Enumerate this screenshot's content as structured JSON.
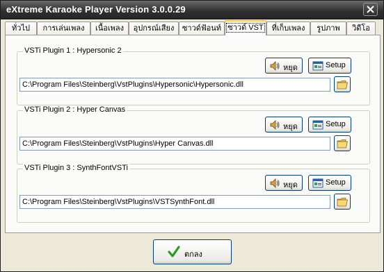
{
  "window": {
    "title": "eXtreme Karaoke Player Version 3.0.0.29"
  },
  "tabs": [
    {
      "label": "ทั่วไป"
    },
    {
      "label": "การเล่นเพลง"
    },
    {
      "label": "เนื้อเพลง"
    },
    {
      "label": "อุปกรณ์เสียง"
    },
    {
      "label": "ซาวด์ฟ้อนท์"
    },
    {
      "label": "ซาวด์ VST",
      "active": true
    },
    {
      "label": "ที่เก็บเพลง"
    },
    {
      "label": "รูปภาพ"
    },
    {
      "label": "วิดีโอ"
    }
  ],
  "plugins": [
    {
      "title": "VSTi Plugin 1 : Hypersonic 2",
      "stop_label": "หยุด",
      "setup_label": "Setup",
      "path": "C:\\Program Files\\Steinberg\\VstPlugins\\Hypersonic\\Hypersonic.dll"
    },
    {
      "title": "VSTi Plugin 2 : Hyper Canvas",
      "stop_label": "หยุด",
      "setup_label": "Setup",
      "path": "C:\\Program Files\\Steinberg\\VstPlugins\\Hyper Canvas.dll"
    },
    {
      "title": "VSTi Plugin 3 : SynthFontVSTi",
      "stop_label": "หยุด",
      "setup_label": "Setup",
      "path": "C:\\Program Files\\Steinberg\\VstPlugins\\VSTSynthFont.dll"
    }
  ],
  "footer": {
    "ok_label": "ตกลง"
  },
  "icons": {
    "close": "close-icon",
    "stop": "speaker-icon",
    "setup": "setup-window-icon",
    "browse": "folder-open-icon",
    "ok": "checkmark-icon"
  },
  "colors": {
    "titlebar": "#2f2f2f",
    "face": "#ece9d8",
    "active_tab_highlight": "#ffc83c",
    "ok_check": "#2a9a2a"
  }
}
